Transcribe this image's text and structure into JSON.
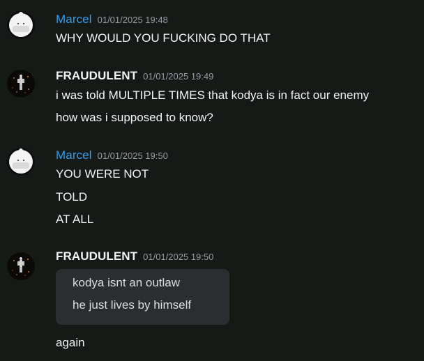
{
  "messages": [
    {
      "author": "Marcel",
      "timestamp": "01/01/2025 19:48",
      "lines": [
        "WHY WOULD YOU FUCKING DO THAT"
      ]
    },
    {
      "author": "FRAUDULENT",
      "timestamp": "01/01/2025 19:49",
      "lines": [
        "i was told MULTIPLE TIMES that kodya is in fact our enemy",
        "how was i supposed to know?"
      ]
    },
    {
      "author": "Marcel",
      "timestamp": "01/01/2025 19:50",
      "lines": [
        "YOU WERE NOT",
        "TOLD",
        "AT ALL"
      ]
    },
    {
      "author": "FRAUDULENT",
      "timestamp": "01/01/2025 19:50",
      "quote": [
        "kodya isnt an outlaw",
        "he just lives by himself"
      ],
      "lines": [
        "again"
      ]
    }
  ],
  "colors": {
    "background": "#161a17",
    "marcel_name": "#2f9ff0",
    "fraudulent_name": "#f2f3f5",
    "timestamp": "#949ba4",
    "quote_bg": "#2b2d31"
  },
  "icons": {
    "marcel_avatar": "astronaut-helmet-avatar-icon",
    "fraudulent_avatar": "dark-sparkle-figure-avatar-icon"
  }
}
